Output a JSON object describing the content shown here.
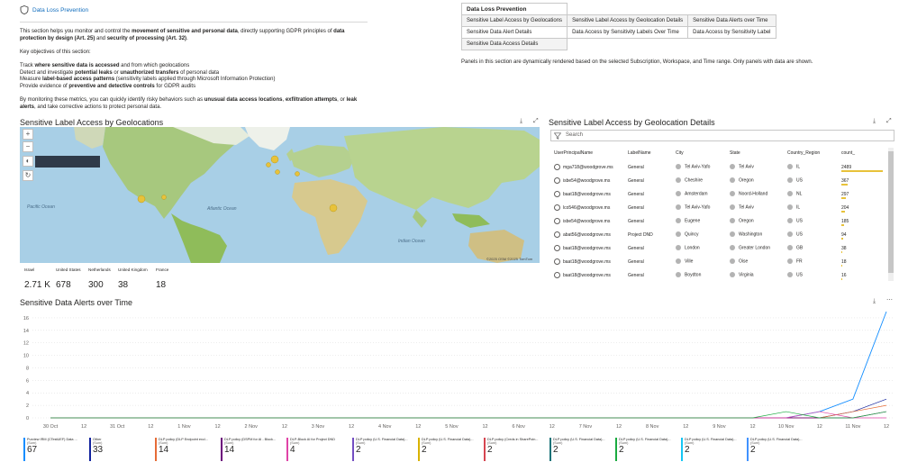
{
  "header": {
    "title": "Data Loss Prevention"
  },
  "intro": {
    "p1_a": "This section helps you monitor and control the ",
    "p1_b": "movement of sensitive and personal data",
    "p1_c": ", directly supporting GDPR principles of ",
    "p1_d": "data protection by design (Art. 25)",
    "p1_e": " and ",
    "p1_f": "security of processing (Art. 32)",
    "p1_g": ".",
    "objectives_label": "Key objectives of this section:",
    "o1_a": "Track ",
    "o1_b": "where sensitive data is accessed",
    "o1_c": " and from which geolocations",
    "o2_a": "Detect and investigate ",
    "o2_b": "potential leaks",
    "o2_c": " or ",
    "o2_d": "unauthorized transfers",
    "o2_e": " of personal data",
    "o3_a": "Measure ",
    "o3_b": "label-based access patterns",
    "o3_c": " (sensitivity labels applied through Microsoft Information Protection)",
    "o4_a": "Provide evidence of ",
    "o4_b": "preventive and detective controls",
    "o4_c": " for GDPR audits",
    "p2_a": "By monitoring these metrics, you can quickly identify risky behaviors such as ",
    "p2_b": "unusual data access locations",
    "p2_c": ", ",
    "p2_d": "exfiltration attempts",
    "p2_e": ", or ",
    "p2_f": "leak alerts",
    "p2_g": ", and take corrective actions to protect personal data."
  },
  "nav": {
    "header": "Data Loss Prevention",
    "r1": [
      "Sensitive Label Access by Geolocations",
      "Sensitive Label Access by Geolocation Details",
      "Sensitive Data Alerts over Time"
    ],
    "r2": [
      "Sensitive Data Alert Details",
      "Data Access by Sensitivity Labels Over Time",
      "Data Access by Sensitivity Label"
    ],
    "r3": [
      "Sensitive Data Access Details"
    ],
    "note": "Panels in this section are dynamically rendered based on the selected Subscription, Workspace, and Time range. Only panels with data are shown."
  },
  "map_panel": {
    "title": "Sensitive Label Access by Geolocations",
    "ocean_labels": [
      "Pacific Ocean",
      "Atlantic Ocean",
      "Indian Ocean"
    ],
    "copyright": "©2025 OSM ©2025 TomTom",
    "legend": [
      {
        "label": "Israel",
        "value": "2.71 K"
      },
      {
        "label": "United States",
        "value": "678"
      },
      {
        "label": "Netherlands",
        "value": "300"
      },
      {
        "label": "United Kingdom",
        "value": "38"
      },
      {
        "label": "France",
        "value": "18"
      }
    ]
  },
  "details_panel": {
    "title": "Sensitive Label Access by Geolocation Details",
    "search_placeholder": "Search",
    "columns": [
      "UserPrincipalName",
      "LabelName",
      "City",
      "State",
      "Country_Region",
      "count_"
    ],
    "rows": [
      [
        "mga718@woodgrove.ms",
        "General",
        "Tel Aviv-Yafo",
        "Tel Aviv",
        "IL",
        "2489"
      ],
      [
        "isbe54@woodgrove.ms",
        "General",
        "Cheshire",
        "Oregon",
        "US",
        "367"
      ],
      [
        "baat18@woodgrove.ms",
        "General",
        "Amsterdam",
        "Noord-Holland",
        "NL",
        "297"
      ],
      [
        "lco546@woodgrove.ms",
        "General",
        "Tel Aviv-Yafo",
        "Tel Aviv",
        "IL",
        "204"
      ],
      [
        "isbe54@woodgrove.ms",
        "General",
        "Eugene",
        "Oregon",
        "US",
        "185"
      ],
      [
        "abat56@woodgrove.ms",
        "Project DND",
        "Quincy",
        "Washington",
        "US",
        "94"
      ],
      [
        "baat18@woodgrove.ms",
        "General",
        "London",
        "Greater London",
        "GB",
        "38"
      ],
      [
        "baat18@woodgrove.ms",
        "General",
        "Ville",
        "Oise",
        "FR",
        "18"
      ],
      [
        "baat18@woodgrove.ms",
        "General",
        "Boydton",
        "Virginia",
        "US",
        "16"
      ]
    ]
  },
  "alerts_panel": {
    "title": "Sensitive Data Alerts over Time",
    "legend": [
      {
        "name": "Purview IRM (CTestUEF) Data ...",
        "sub": "(Sum)",
        "value": "67",
        "color": "#118dff"
      },
      {
        "name": "Other",
        "sub": "(Sum)",
        "value": "33",
        "color": "#12239e"
      },
      {
        "name": "DLP policy (DLP Endpoint excl...",
        "sub": "(Sum)",
        "value": "14",
        "color": "#e66c37"
      },
      {
        "name": "DLP policy (DSPM for AI - Block...",
        "sub": "(Sum)",
        "value": "14",
        "color": "#6b007b"
      },
      {
        "name": "DLP-Block AI for Project DND",
        "sub": "(Sum)",
        "value": "4",
        "color": "#e044a7"
      },
      {
        "name": "DLP policy (U.S. Financial Data)...",
        "sub": "(Sum)",
        "value": "2",
        "color": "#744ec2"
      },
      {
        "name": "DLP policy (U.S. Financial Data)...",
        "sub": "(Sum)",
        "value": "2",
        "color": "#d9b300"
      },
      {
        "name": "DLP policy (Creds in SharePoin...",
        "sub": "(Sum)",
        "value": "2",
        "color": "#d64550"
      },
      {
        "name": "DLP policy (U.S. Financial Data)...",
        "sub": "(Sum)",
        "value": "2",
        "color": "#197278"
      },
      {
        "name": "DLP policy (U.S. Financial Data)...",
        "sub": "(Sum)",
        "value": "2",
        "color": "#1aab40"
      },
      {
        "name": "DLP policy (U.S. Financial Data)...",
        "sub": "(Sum)",
        "value": "2",
        "color": "#15c6f4"
      },
      {
        "name": "DLP policy (U.S. Financial Data)...",
        "sub": "(Sum)",
        "value": "2",
        "color": "#4092ff"
      }
    ]
  },
  "chart_data": {
    "type": "line",
    "title": "Sensitive Data Alerts over Time",
    "x": [
      "30 Oct",
      "12",
      "31 Oct",
      "12",
      "1 Nov",
      "12",
      "2 Nov",
      "12",
      "3 Nov",
      "12",
      "4 Nov",
      "12",
      "5 Nov",
      "12",
      "6 Nov",
      "12",
      "7 Nov",
      "12",
      "8 Nov",
      "12",
      "9 Nov",
      "12",
      "10 Nov",
      "12",
      "11 Nov",
      "12"
    ],
    "ylim": [
      0,
      17
    ],
    "yticks": [
      0,
      2,
      4,
      6,
      8,
      10,
      12,
      14,
      16
    ],
    "grid": true,
    "series": [
      {
        "name": "Purview IRM (CTestUEF) Data ...",
        "color": "#118dff",
        "values": [
          0,
          0,
          0,
          0,
          0,
          0,
          0,
          0,
          0,
          0,
          0,
          0,
          0,
          0,
          0,
          0,
          0,
          0,
          0,
          0,
          0,
          0,
          0,
          1,
          3,
          17
        ]
      },
      {
        "name": "Other",
        "color": "#12239e",
        "values": [
          0,
          0,
          0,
          0,
          0,
          0,
          0,
          0,
          0,
          0,
          0,
          0,
          0,
          0,
          0,
          0,
          0,
          0,
          0,
          0,
          0,
          0,
          0,
          0,
          1,
          3
        ]
      },
      {
        "name": "DLP policy (DLP Endpoint excl...",
        "color": "#e66c37",
        "values": [
          0,
          0,
          0,
          0,
          0,
          0,
          0,
          0,
          0,
          0,
          0,
          0,
          0,
          0,
          0,
          0,
          0,
          0,
          0,
          0,
          0,
          0,
          0,
          0,
          1,
          2
        ]
      },
      {
        "name": "DLP policy (DSPM for AI - Block...",
        "color": "#6b007b",
        "values": [
          0,
          0,
          0,
          0,
          0,
          0,
          0,
          0,
          0,
          0,
          0,
          0,
          0,
          0,
          0,
          0,
          0,
          0,
          0,
          0,
          0,
          0,
          0,
          0,
          0,
          1
        ]
      },
      {
        "name": "DLP-Block AI for Project DND",
        "color": "#e044a7",
        "values": [
          0,
          0,
          0,
          0,
          0,
          0,
          0,
          0,
          0,
          0,
          0,
          0,
          0,
          0,
          0,
          0,
          0,
          0,
          0,
          0,
          0,
          0,
          0,
          1,
          0,
          0
        ]
      },
      {
        "name": "DLP policy (U.S. Financial Data)...",
        "color": "#1aab40",
        "values": [
          0,
          0,
          0,
          0,
          0,
          0,
          0,
          0,
          0,
          0,
          0,
          0,
          0,
          0,
          0,
          0,
          0,
          0,
          0,
          0,
          0,
          0,
          1,
          0,
          0,
          1
        ]
      }
    ]
  }
}
